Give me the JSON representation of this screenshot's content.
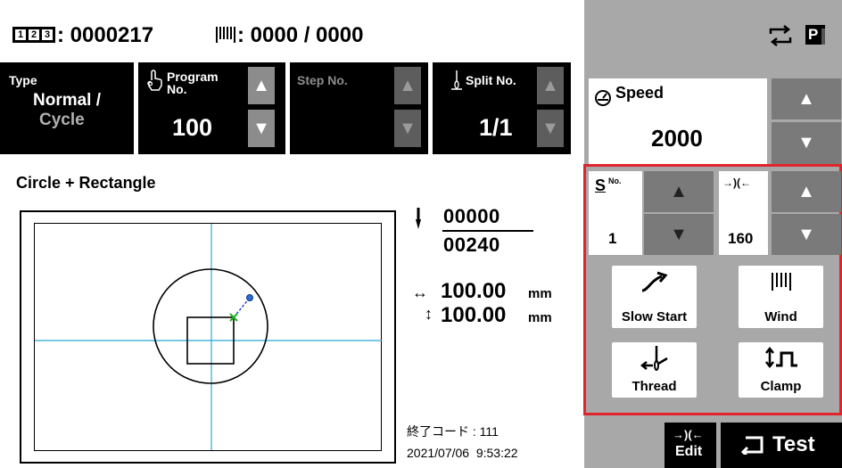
{
  "top": {
    "program_counter": ": 0000217",
    "wind_counter": ": 0000 / 0000"
  },
  "header": {
    "type_label": "Type",
    "type_value_1": "Normal /",
    "type_value_2": "Cycle",
    "program_label_1": "Program",
    "program_label_2": "No.",
    "program_value": "100",
    "step_label": "Step No.",
    "split_label": "Split No.",
    "split_value": "1/1"
  },
  "pattern": {
    "name": "Circle + Rectangle",
    "stitch_current": "00000",
    "stitch_total": "00240",
    "width_value": "100.00",
    "width_unit": "mm",
    "height_value": "100.00",
    "height_unit": "mm",
    "end_code": "終了コード : 111",
    "datetime": "2021/07/06  9:53:22"
  },
  "right": {
    "speed_label": "Speed",
    "speed_value": "2000",
    "s_no_label": "No.",
    "s_no_value": "1",
    "tension_value": "160",
    "slow_start_label": "Slow Start",
    "wind_label": "Wind",
    "thread_label": "Thread",
    "clamp_label": "Clamp",
    "edit_label_top": "→)(←",
    "edit_label": "Edit",
    "test_label": "Test"
  },
  "colors": {
    "highlight": "#e0242c",
    "grid_line": "#2aa8d8",
    "panel": "#a8a8a8",
    "gray_button": "#7a7a7a"
  },
  "icons": {
    "sync": "sync-icon",
    "print": "p-icon",
    "program": "program-touch-icon",
    "needle": "needle-icon",
    "speed": "speed-gauge-icon"
  }
}
